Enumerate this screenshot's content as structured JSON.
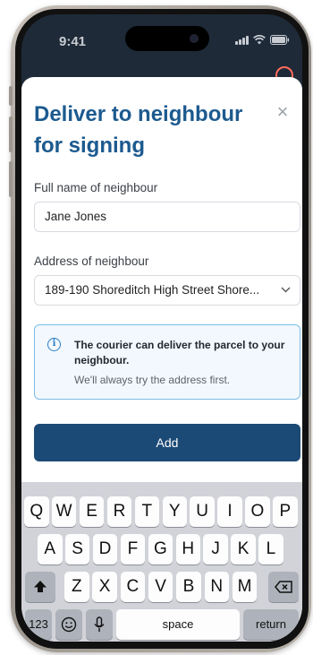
{
  "status_bar": {
    "time": "9:41"
  },
  "sheet": {
    "title": "Deliver to neighbour for signing",
    "close_glyph": "×"
  },
  "form": {
    "name_label": "Full name of neighbour",
    "name_value": "Jane Jones",
    "address_label": "Address of neighbour",
    "address_value": "189-190 Shoreditch High Street Shore..."
  },
  "info": {
    "glyph": "i",
    "title": "The courier can deliver the parcel to your neighbour.",
    "subtitle": "We'll always try the address first."
  },
  "primary_button": {
    "label": "Add"
  },
  "keyboard": {
    "row1": [
      "Q",
      "W",
      "E",
      "R",
      "T",
      "Y",
      "U",
      "I",
      "O",
      "P"
    ],
    "row2": [
      "A",
      "S",
      "D",
      "F",
      "G",
      "H",
      "J",
      "K",
      "L"
    ],
    "row3": [
      "Z",
      "X",
      "C",
      "V",
      "B",
      "N",
      "M"
    ],
    "numbers_label": "123",
    "space_label": "space",
    "return_label": "return"
  },
  "colors": {
    "title": "#1c5a8f",
    "primary_button": "#1c4a76",
    "info_border": "#7dbde8",
    "info_icon": "#2a7fc9",
    "app_background": "#1e2a38"
  },
  "icons": {
    "back": "arrow-left-icon",
    "help": "help-circle-icon",
    "close": "close-icon",
    "select": "chevron-down-icon",
    "info": "info-icon",
    "shift": "shift-icon",
    "backspace": "backspace-icon",
    "emoji": "emoji-icon",
    "mic": "microphone-icon"
  }
}
